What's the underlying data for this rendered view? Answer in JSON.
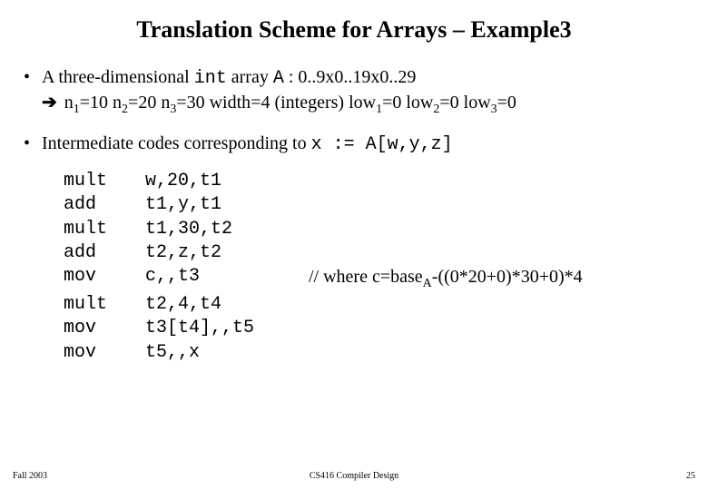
{
  "title": "Translation Scheme for Arrays – Example3",
  "b1": {
    "pre": "A three-dimensional ",
    "kw": "int",
    "mid": " array ",
    "arr": "A",
    "rest": " : 0..9x0..19x0..29"
  },
  "b1line2": {
    "arrow": "➔",
    "n1a": "  n",
    "n1b": "=10  n",
    "n2b": "=20  n",
    "n3b": "=30  width=4 (integers)  low",
    "l1": "=0  low",
    "l2": "=0  low",
    "l3": "=0"
  },
  "b2": {
    "text": "Intermediate codes corresponding to   ",
    "code": "x := A[w,y,z]"
  },
  "code": [
    {
      "op": "mult",
      "args": "w,20,t1",
      "comment": ""
    },
    {
      "op": "add",
      "args": "t1,y,t1",
      "comment": ""
    },
    {
      "op": "mult",
      "args": "t1,30,t2",
      "comment": ""
    },
    {
      "op": "add",
      "args": "t2,z,t2",
      "comment": ""
    },
    {
      "op": "mov",
      "args": "c,,t3",
      "comment": "// where c=base"
    },
    {
      "op": "mult",
      "args": "t2,4,t4",
      "comment": ""
    },
    {
      "op": "mov",
      "args": "t3[t4],,t5",
      "comment": ""
    },
    {
      "op": "mov",
      "args": "t5,,x",
      "comment": ""
    }
  ],
  "commentSuffix": "-((0*20+0)*30+0)*4",
  "footer": {
    "left": "Fall 2003",
    "center": "CS416 Compiler Design",
    "right": "25"
  }
}
